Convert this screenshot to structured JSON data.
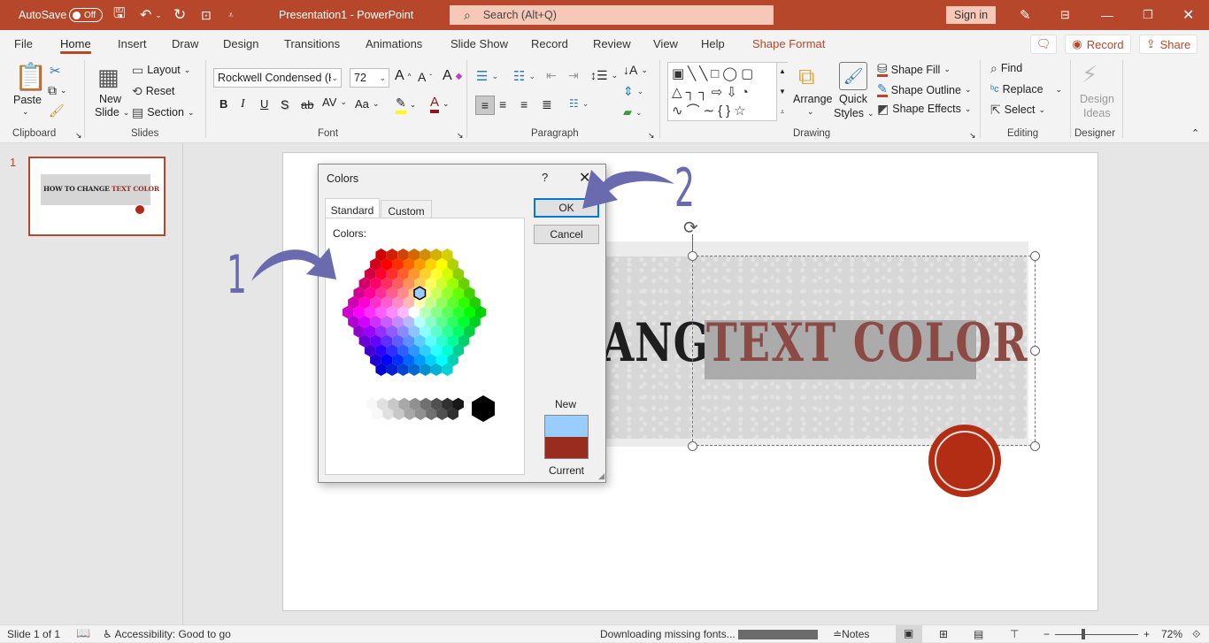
{
  "titlebar": {
    "autosave_label": "AutoSave",
    "autosave_state": "Off",
    "document_title": "Presentation1  -  PowerPoint",
    "search_placeholder": "Search (Alt+Q)",
    "sign_in": "Sign in",
    "icons": [
      "save-icon",
      "undo-icon",
      "redo-icon",
      "start-presentation-icon",
      "customize-toolbar-icon",
      "pen-icon",
      "ribbon-display-icon",
      "minimize-icon",
      "restore-icon",
      "close-icon"
    ],
    "accent": "#b7472a"
  },
  "tabs": [
    {
      "label": "File"
    },
    {
      "label": "Home",
      "active": true
    },
    {
      "label": "Insert"
    },
    {
      "label": "Draw"
    },
    {
      "label": "Design"
    },
    {
      "label": "Transitions"
    },
    {
      "label": "Animations"
    },
    {
      "label": "Slide Show"
    },
    {
      "label": "Record"
    },
    {
      "label": "Review"
    },
    {
      "label": "View"
    },
    {
      "label": "Help"
    },
    {
      "label": "Shape Format",
      "contextual": true
    }
  ],
  "top_right": {
    "record": "Record",
    "share": "Share"
  },
  "ribbon": {
    "clipboard": {
      "label": "Clipboard",
      "paste": "Paste"
    },
    "slides": {
      "label": "Slides",
      "new_slide_1": "New",
      "new_slide_2": "Slide",
      "layout": "Layout",
      "reset": "Reset",
      "section": "Section"
    },
    "font": {
      "label": "Font",
      "font_name": "Rockwell Condensed (Hea",
      "font_size": "72",
      "bold": "B",
      "italic": "I",
      "underline": "U",
      "shadow": "S",
      "strike": "ab",
      "spacing": "AV",
      "case": "Aa",
      "grow": "A",
      "shrink": "A",
      "clear": "A",
      "font_color": "A",
      "highlight_color": "#ffff00",
      "font_color_hex": "#8b1a1a"
    },
    "paragraph": {
      "label": "Paragraph"
    },
    "drawing": {
      "label": "Drawing",
      "arrange": "Arrange",
      "quick_1": "Quick",
      "quick_2": "Styles",
      "shape_fill": "Shape Fill",
      "shape_outline": "Shape Outline",
      "shape_effects": "Shape Effects"
    },
    "editing": {
      "label": "Editing",
      "find": "Find",
      "replace": "Replace",
      "select": "Select"
    },
    "designer": {
      "label": "Designer",
      "design_1": "Design",
      "design_2": "Ideas"
    }
  },
  "thumbnails": [
    {
      "number": "1",
      "text_dark": "HOW TO CHANGE ",
      "text_red": "TEXT COLOR"
    }
  ],
  "slide": {
    "title_visible_dark": "ANGE",
    "title_red": "TEXT COLOR"
  },
  "dialog": {
    "title": "Colors",
    "help": "?",
    "close": "✕",
    "tabs": [
      {
        "label": "Standard",
        "active": true
      },
      {
        "label": "Custom"
      }
    ],
    "colors_label": "Colors:",
    "ok": "OK",
    "cancel": "Cancel",
    "new_label": "New",
    "current_label": "Current",
    "new_color": "#99ccff",
    "current_color": "#992b1f"
  },
  "annotations": {
    "step1": "1",
    "step2": "2",
    "color": "#6a6aaf"
  },
  "status": {
    "slide_counter": "Slide 1 of 1",
    "accessibility": "Accessibility: Good to go",
    "downloading": "Downloading missing fonts...",
    "notes": "Notes",
    "zoom": "72%"
  }
}
